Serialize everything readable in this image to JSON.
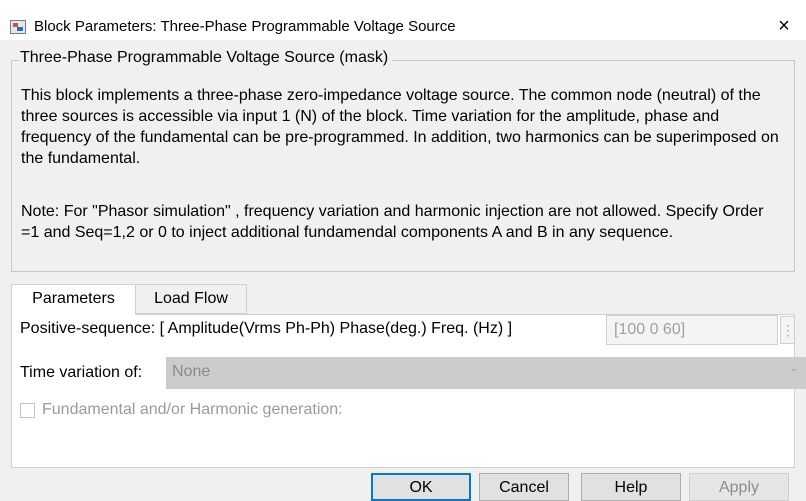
{
  "window": {
    "title": "Block Parameters: Three-Phase Programmable Voltage Source",
    "close_glyph": "×",
    "icon": "simulink-block-icon"
  },
  "mask": {
    "legend": "Three-Phase Programmable Voltage Source (mask)",
    "description": "This block implements a three-phase zero-impedance voltage source. The common node (neutral) of the three sources is accessible via input 1 (N) of the block. Time variation for the amplitude, phase and frequency of the fundamental can be pre-programmed. In addition, two harmonics can be superimposed on the fundamental.",
    "note": "Note: For  \"Phasor simulation\" , frequency variation and harmonic injection are not allowed. Specify  Order =1 and Seq=1,2 or 0 to inject additional fundamendal components A and B in any sequence."
  },
  "tabs": [
    {
      "label": "Parameters",
      "active": true
    },
    {
      "label": "Load Flow",
      "active": false
    }
  ],
  "parameters": {
    "positive_sequence_label": "Positive-sequence: [ Amplitude(Vrms Ph-Ph)  Phase(deg.)  Freq. (Hz) ]",
    "positive_sequence_value": "[100  0 60]",
    "more_glyph": "⋮",
    "time_variation_label": "Time variation of:",
    "time_variation_value": "None",
    "time_variation_caret": "⌄",
    "fundamental_label": "Fundamental and/or Harmonic generation:",
    "fundamental_checked": false
  },
  "buttons": {
    "ok": "OK",
    "cancel": "Cancel",
    "help": "Help",
    "apply": "Apply"
  },
  "colors": {
    "default_button_border": "#0078d7",
    "disabled_text": "#8c8c8c"
  }
}
